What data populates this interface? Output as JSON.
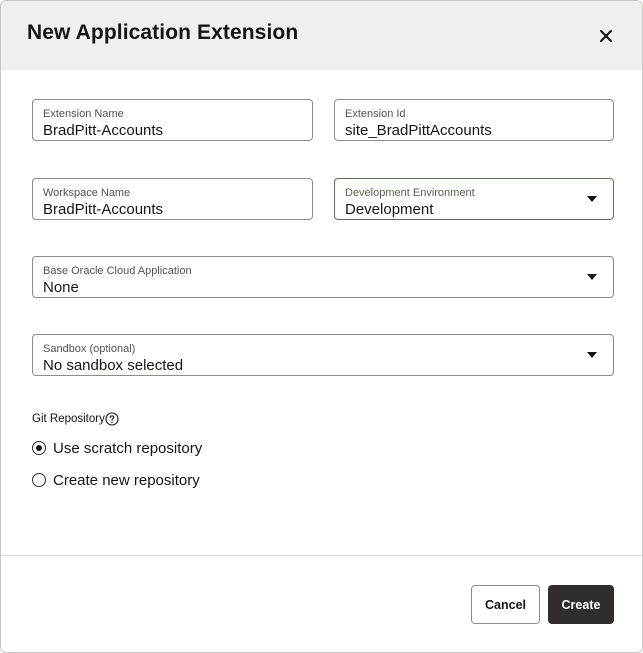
{
  "dialog": {
    "title": "New Application Extension",
    "close_icon": "close-icon"
  },
  "fields": {
    "extension_name": {
      "label": "Extension Name",
      "value": "BradPitt-Accounts"
    },
    "extension_id": {
      "label": "Extension Id",
      "value": "site_BradPittAccounts"
    },
    "workspace_name": {
      "label": "Workspace Name",
      "value": "BradPitt-Accounts"
    },
    "development_environment": {
      "label": "Development Environment",
      "value": "Development"
    },
    "base_app": {
      "label": "Base Oracle Cloud Application",
      "value": "None"
    },
    "sandbox": {
      "label": "Sandbox (optional)",
      "value": "No sandbox selected"
    }
  },
  "git": {
    "label": "Git Repository",
    "help_icon": "help-icon",
    "options": [
      {
        "label": "Use scratch repository",
        "selected": true
      },
      {
        "label": "Create new repository",
        "selected": false
      }
    ]
  },
  "footer": {
    "cancel_label": "Cancel",
    "create_label": "Create"
  },
  "colors": {
    "header_bg": "#f1efed",
    "primary_button": "#312d2a",
    "focused_field_label": "#4f6748"
  }
}
